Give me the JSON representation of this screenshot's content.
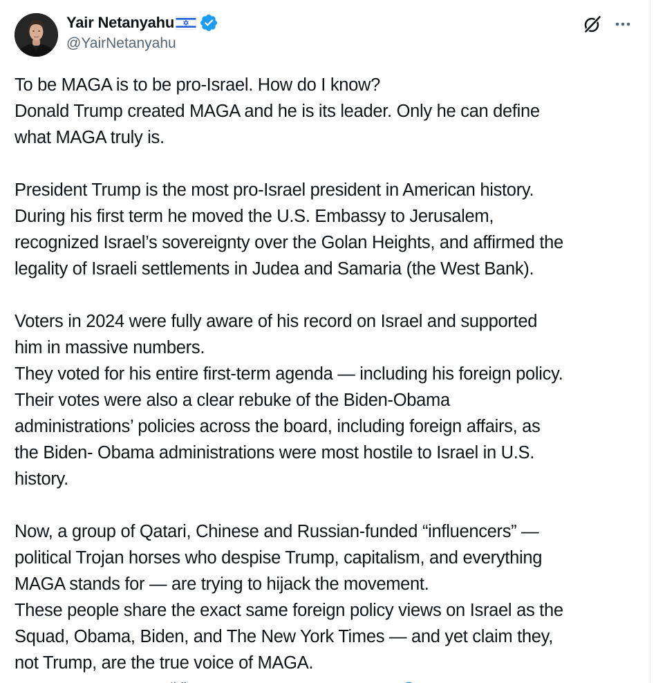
{
  "author": {
    "display_name": "Yair Netanyahu",
    "handle": "@YairNetanyahu",
    "avatar_icon": "profile-photo",
    "flag_icon": "israel-flag",
    "verified_icon": "verified-badge",
    "verified_color": "#1d9bf0"
  },
  "actions": {
    "grok_icon": "grok-icon",
    "more_icon": "more-options-icon"
  },
  "tweet": {
    "lines": [
      "To be MAGA is to be pro-Israel. How do I know?",
      "Donald Trump created MAGA and he is its leader. Only he can define",
      "what MAGA truly is.",
      "",
      "President Trump is the most pro-Israel president in American history.",
      "During his first term he moved the U.S. Embassy to Jerusalem,",
      "recognized Israel’s sovereignty over the Golan Heights, and affirmed the",
      "legality of Israeli settlements in Judea and Samaria (the West Bank).",
      "",
      "Voters in 2024 were fully aware of his record on Israel and supported",
      "him in massive numbers.",
      "They voted for his entire first-term agenda — including his foreign policy.",
      "Their votes were also a clear rebuke of the Biden-Obama",
      "administrations’ policies across the board, including foreign affairs, as",
      "the Biden- Obama administrations were most hostile to Israel in U.S.",
      "history.",
      "",
      "Now, a group of Qatari, Chinese and Russian-funded “influencers” —",
      "political Trojan horses who despise Trump, capitalism, and everything",
      "MAGA stands for — are trying to hijack the movement.",
      "These people share the exact same foreign policy views on Israel as the",
      "Squad, Obama, Biden, and The New York Times — and yet claim they,",
      "not Trump, are the true voice of MAGA."
    ]
  },
  "colors": {
    "text": "#0f1419",
    "secondary": "#536471",
    "link": "#1d9bf0",
    "background": "#ffffff"
  }
}
